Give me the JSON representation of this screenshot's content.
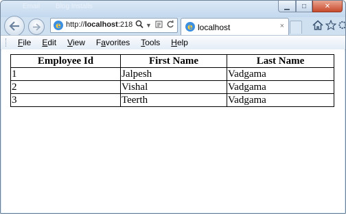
{
  "window": {
    "background_tabs": [
      "Email",
      "Blog Installs"
    ],
    "buttons": {
      "minimize": "▁",
      "maximize": "□",
      "close": "✕"
    }
  },
  "nav": {
    "back_icon": "back-arrow-icon",
    "forward_icon": "forward-arrow-icon"
  },
  "address_bar": {
    "url_prefix": "http://",
    "url_host": "localhost",
    "url_rest": ":218",
    "icons": [
      "search-icon",
      "dropdown-icon",
      "compat-view-icon",
      "refresh-icon"
    ]
  },
  "tab": {
    "title": "localhost",
    "close": "×"
  },
  "toolbar_right": [
    "home-icon",
    "favorites-icon",
    "tools-gear-icon"
  ],
  "menu": {
    "items": [
      {
        "label_u": "F",
        "label_rest": "ile"
      },
      {
        "label_u": "E",
        "label_rest": "dit"
      },
      {
        "label_u": "V",
        "label_rest": "iew"
      },
      {
        "label_pre": "F",
        "label_u": "a",
        "label_rest": "vorites"
      },
      {
        "label_u": "T",
        "label_rest": "ools"
      },
      {
        "label_u": "H",
        "label_rest": "elp"
      }
    ]
  },
  "table": {
    "headers": [
      "Employee Id",
      "First Name",
      "Last Name"
    ],
    "rows": [
      [
        "1",
        "Jalpesh",
        "Vadgama"
      ],
      [
        "2",
        "Vishal",
        "Vadgama"
      ],
      [
        "3",
        "Teerth",
        "Vadgama"
      ]
    ]
  },
  "colors": {
    "frame": "#cfe0f1",
    "close_button": "#c7492d",
    "ie_logo": "#3d8fe0"
  }
}
